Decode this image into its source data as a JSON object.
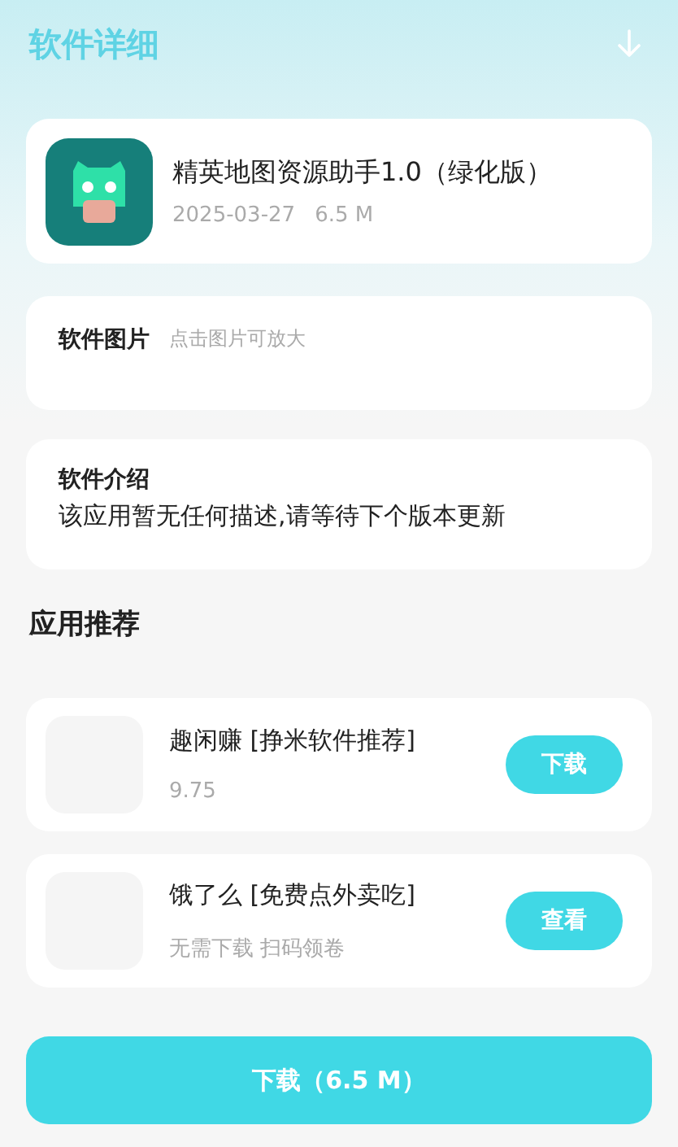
{
  "header": {
    "title": "软件详细"
  },
  "app": {
    "name": "精英地图资源助手1.0（绿化版）",
    "date": "2025-03-27",
    "size": "6.5 M"
  },
  "screenshots": {
    "label": "软件图片",
    "hint": "点击图片可放大"
  },
  "intro": {
    "label": "软件介绍",
    "text": "该应用暂无任何描述,请等待下个版本更新"
  },
  "recommend": {
    "title": "应用推荐",
    "items": [
      {
        "name": "趣闲赚 [挣米软件推荐]",
        "sub": "9.75",
        "button": "下载"
      },
      {
        "name": "饿了么 [免费点外卖吃]",
        "sub": "无需下载 扫码领卷",
        "button": "查看"
      }
    ]
  },
  "download_button": "下载（6.5 M）"
}
